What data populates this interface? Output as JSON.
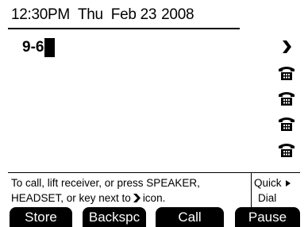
{
  "status": {
    "time": "12:30PM",
    "day": "Thu",
    "date": "Feb 23",
    "year": "2008"
  },
  "dial": {
    "entry": "9-6"
  },
  "side_icons": [
    "arrow-right-icon",
    "phone-icon",
    "phone-icon",
    "phone-icon",
    "phone-icon"
  ],
  "info": {
    "line1": "To call, lift receiver, or press SPEAKER,",
    "line2_before": "HEADSET, or key  next to",
    "line2_after": "icon."
  },
  "quick_dial": {
    "line1": "Quick",
    "line2": "Dial"
  },
  "softkeys": {
    "store": "Store",
    "backspace": "Backspc",
    "call": "Call",
    "pause": "Pause"
  }
}
